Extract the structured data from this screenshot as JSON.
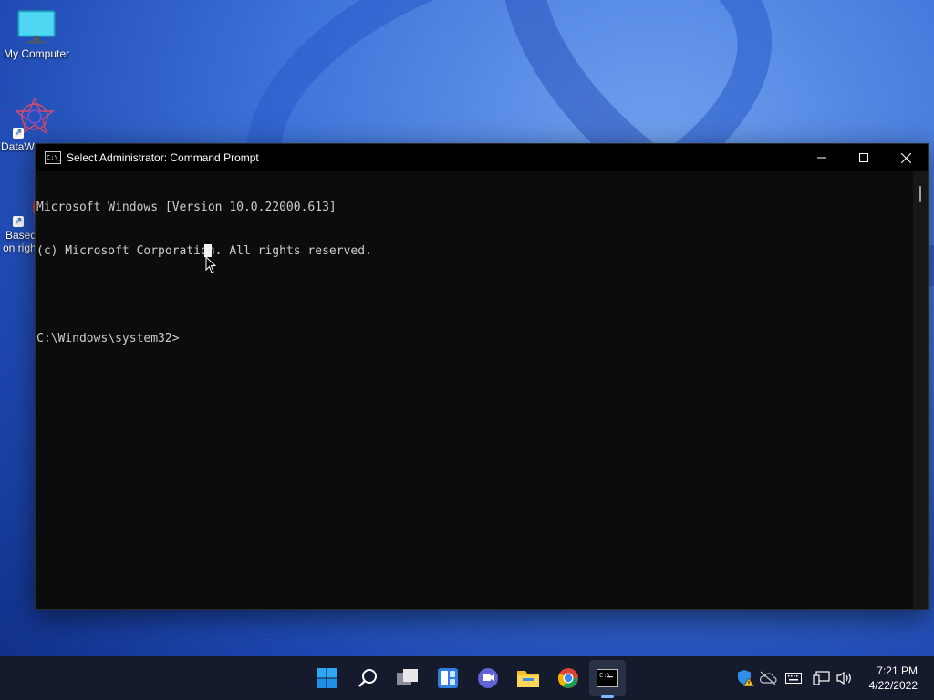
{
  "desktop": {
    "icons": [
      {
        "label": "My Computer"
      },
      {
        "label": "DataW"
      },
      {
        "label": "Based on right"
      }
    ]
  },
  "window": {
    "title": "Select Administrator: Command Prompt",
    "icon_text": "C:\\_",
    "minimize_icon": "minimize-icon",
    "maximize_icon": "maximize-icon",
    "close_icon": "close-icon"
  },
  "console": {
    "lines": [
      "Microsoft Windows [Version 10.0.22000.613]",
      "(c) Microsoft Corporation. All rights reserved.",
      "",
      "C:\\Windows\\system32>"
    ]
  },
  "taskbar": {
    "apps": [
      "start-icon",
      "search-icon",
      "task-view-icon",
      "widgets-icon",
      "teams-chat-icon",
      "file-explorer-icon",
      "chrome-icon",
      "command-prompt-icon"
    ],
    "tray": [
      "defender-warning-icon",
      "onedrive-icon",
      "keyboard-icon",
      "network-icon",
      "volume-icon"
    ],
    "clock": {
      "time": "7:21 PM",
      "date": "4/22/2022"
    }
  },
  "colors": {
    "console_bg": "#0c0c0c",
    "console_text": "#cccccc",
    "taskbar_bg": "#151b2d"
  }
}
